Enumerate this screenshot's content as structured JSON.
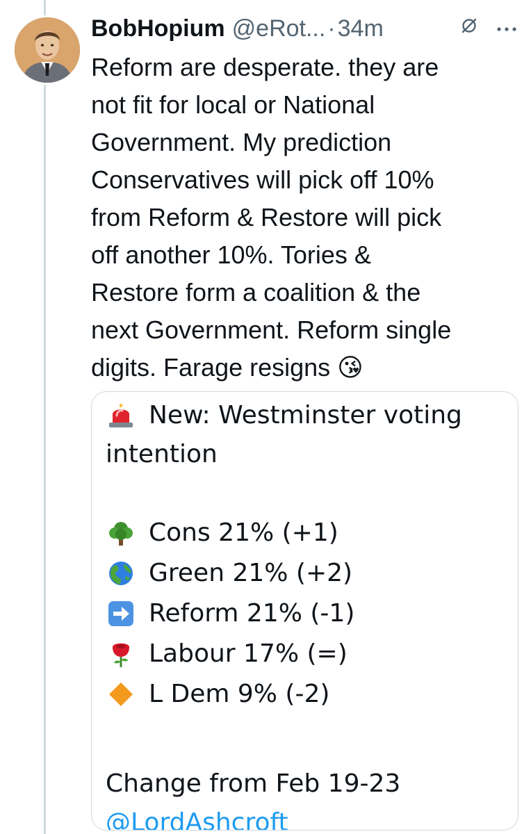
{
  "tweet": {
    "display_name": "BobHopium",
    "handle": "@eRot...",
    "separator": "·",
    "time": "34m",
    "text": "Reform are desperate. they are\nnot fit for local or National\nGovernment. My prediction\nConservatives will pick off 10%\nfrom Reform & Restore will pick\noff another 10%. Tories &\nRestore form a coalition & the\nnext Government. Reform single\ndigits. Farage resigns 😘"
  },
  "quoted": {
    "headline_line1": "New: Westminster voting",
    "headline_line2": "intention",
    "rows": [
      {
        "icon": "tree-icon",
        "label": "Cons 21% (+1)"
      },
      {
        "icon": "globe-icon",
        "label": "Green 21% (+2)"
      },
      {
        "icon": "right-arrow-icon",
        "label": "Reform 21% (-1)"
      },
      {
        "icon": "rose-icon",
        "label": "Labour 17% (=)"
      },
      {
        "icon": "orange-diamond-icon",
        "label": "L Dem 9% (-2)"
      }
    ],
    "change_note": "Change from Feb 19-23",
    "mention": "@LordAshcroft"
  },
  "colors": {
    "text": "#0f1419",
    "secondary": "#536471",
    "link": "#1d9bf0",
    "border": "#cfd9de"
  }
}
